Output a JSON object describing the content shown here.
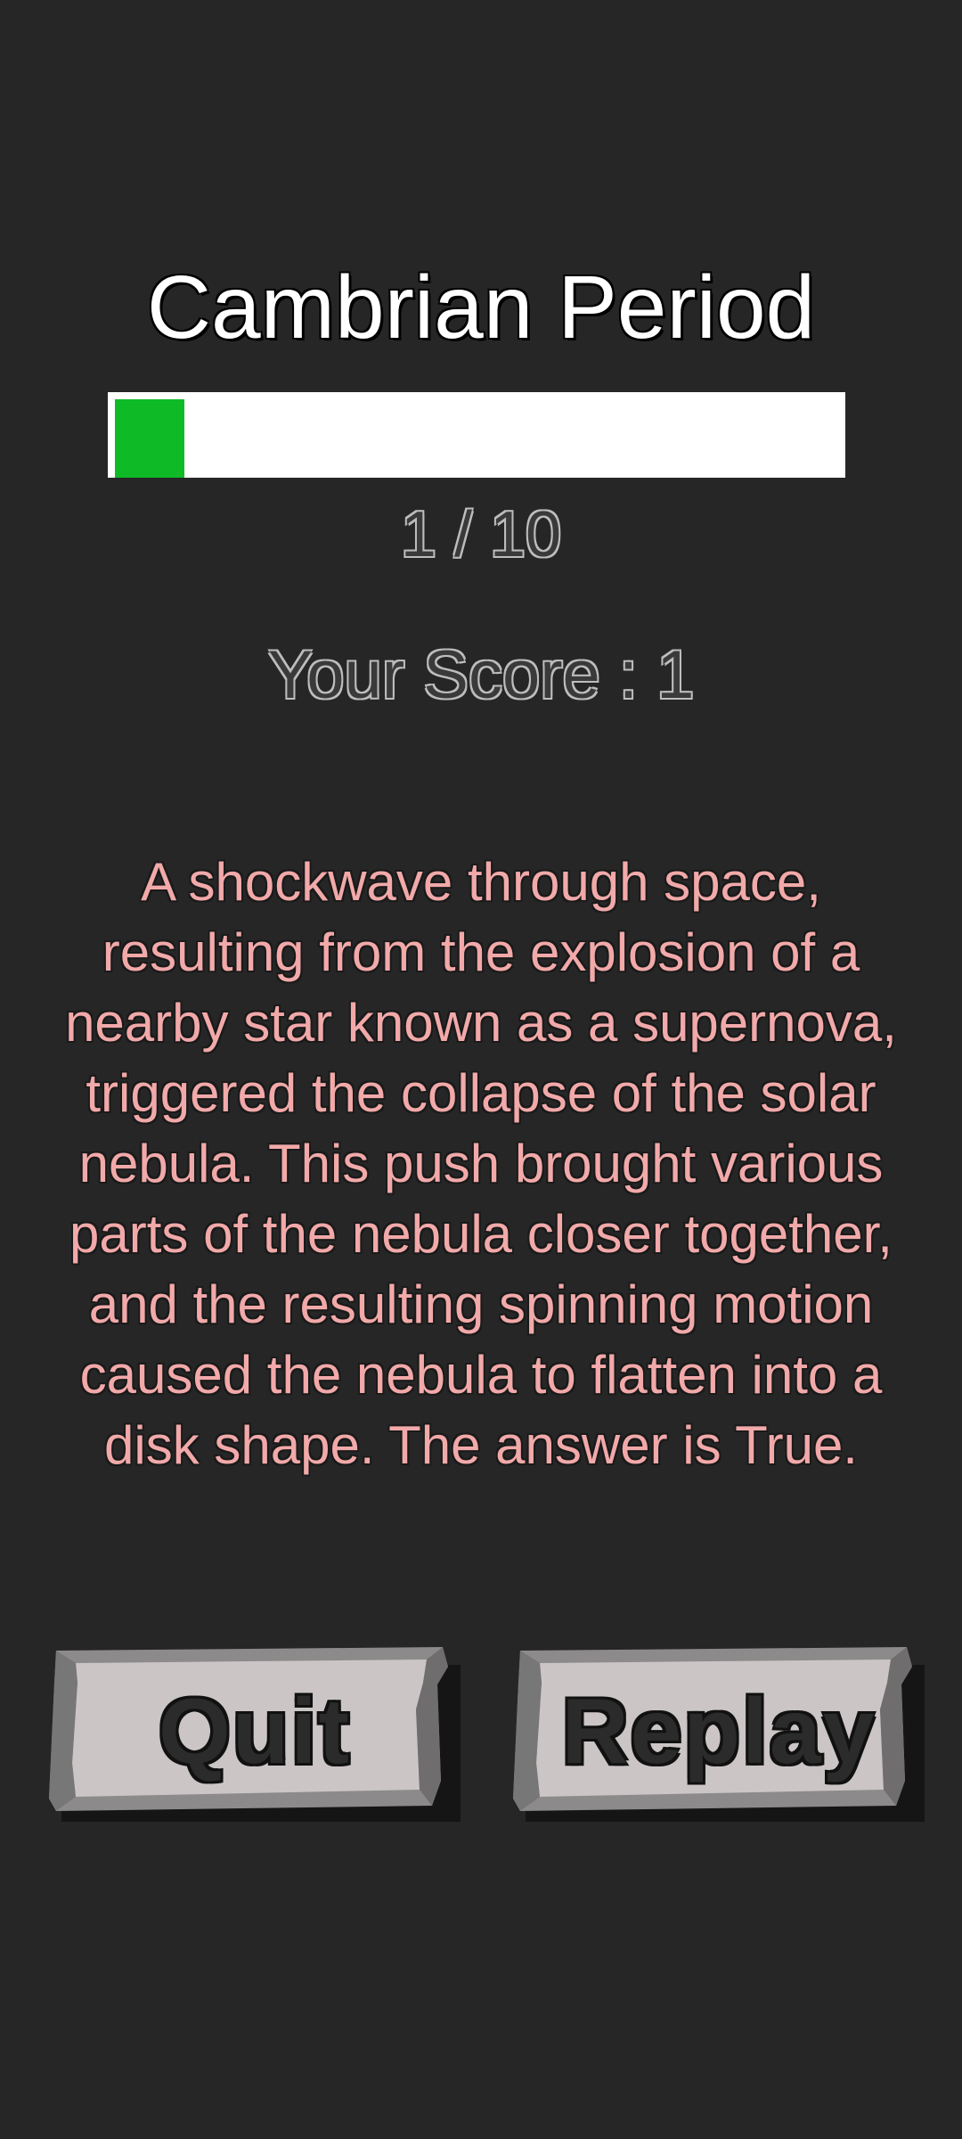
{
  "header": {
    "title": "Cambrian Period"
  },
  "progress": {
    "current": 1,
    "total": 10,
    "fraction": 0.1,
    "label": "1 / 10",
    "fill_color": "#0ebb27"
  },
  "score": {
    "label": "Your Score : 1"
  },
  "explanation": {
    "text": "A shockwave through space, resulting from the explosion of a nearby star known as a supernova, triggered the collapse of the solar nebula. This push brought various parts of the nebula closer together, and the resulting spinning motion caused the nebula to flatten into a disk shape. The answer is True.",
    "color": "#f2a9a9"
  },
  "buttons": {
    "quit_label": "Quit",
    "replay_label": "Replay",
    "stone_color": "#c8c4c4"
  }
}
